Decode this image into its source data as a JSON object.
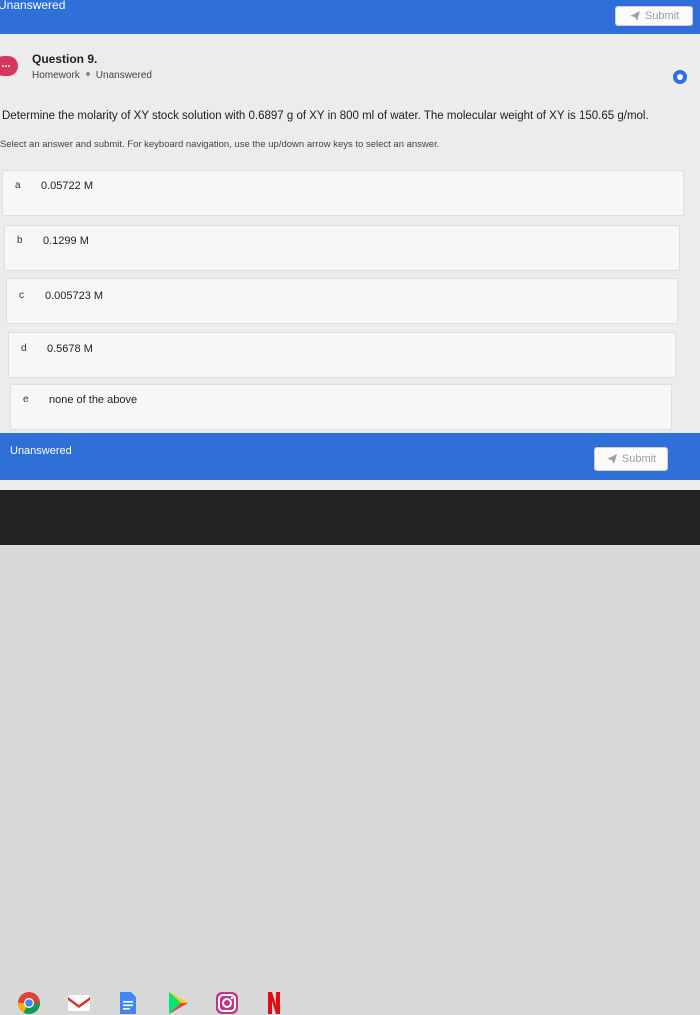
{
  "header": {
    "status": "Unanswered",
    "submit_label": "Submit"
  },
  "question": {
    "badge": "...",
    "title": "Question 9.",
    "type": "Homework",
    "status": "Unanswered",
    "text": "Determine the molarity of XY stock solution with 0.6897 g of XY in 800 ml of water. The molecular weight of XY is 150.65 g/mol.",
    "hint": "Select an answer and submit. For keyboard navigation, use the up/down arrow keys to select an answer."
  },
  "options": [
    {
      "letter": "a",
      "text": "0.05722 M"
    },
    {
      "letter": "b",
      "text": "0.1299 M"
    },
    {
      "letter": "c",
      "text": "0.005723 M"
    },
    {
      "letter": "d",
      "text": "0.5678 M"
    },
    {
      "letter": "e",
      "text": "none of the above"
    }
  ],
  "footer": {
    "status": "Unanswered",
    "submit_label": "Submit"
  },
  "shelf": {
    "apps": [
      "chrome-icon",
      "gmail-icon",
      "docs-icon",
      "play-store-icon",
      "instagram-icon",
      "netflix-icon"
    ]
  },
  "colors": {
    "accent": "#2f6fd8",
    "badge": "#d9365f",
    "shelf": "#232323"
  }
}
